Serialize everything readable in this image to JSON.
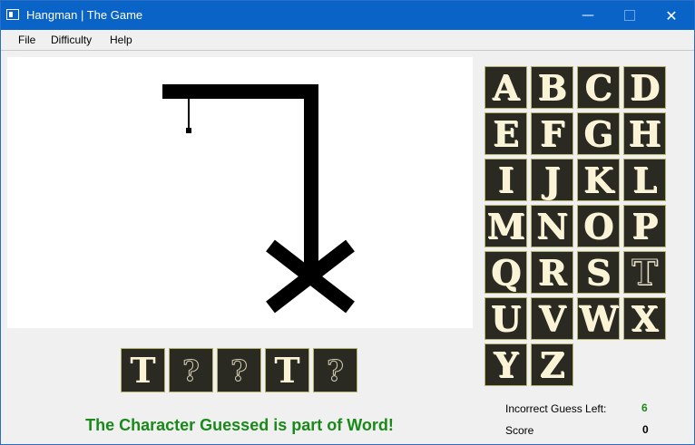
{
  "window": {
    "title": "Hangman | The Game",
    "minimize_glyph": "—",
    "close_glyph": "✕"
  },
  "menu": {
    "items": [
      "File",
      "Difficulty",
      "Help"
    ]
  },
  "keyboard": {
    "letters": [
      {
        "letter": "A",
        "used": false
      },
      {
        "letter": "B",
        "used": false
      },
      {
        "letter": "C",
        "used": false
      },
      {
        "letter": "D",
        "used": false
      },
      {
        "letter": "E",
        "used": false
      },
      {
        "letter": "F",
        "used": false
      },
      {
        "letter": "G",
        "used": false
      },
      {
        "letter": "H",
        "used": false
      },
      {
        "letter": "I",
        "used": false
      },
      {
        "letter": "J",
        "used": false
      },
      {
        "letter": "K",
        "used": false
      },
      {
        "letter": "L",
        "used": false
      },
      {
        "letter": "M",
        "used": false
      },
      {
        "letter": "N",
        "used": false
      },
      {
        "letter": "O",
        "used": false
      },
      {
        "letter": "P",
        "used": false
      },
      {
        "letter": "Q",
        "used": false
      },
      {
        "letter": "R",
        "used": false
      },
      {
        "letter": "S",
        "used": false
      },
      {
        "letter": "T",
        "used": true
      },
      {
        "letter": "U",
        "used": false
      },
      {
        "letter": "V",
        "used": false
      },
      {
        "letter": "W",
        "used": false
      },
      {
        "letter": "X",
        "used": false
      },
      {
        "letter": "Y",
        "used": false
      },
      {
        "letter": "Z",
        "used": false
      }
    ]
  },
  "word": {
    "slots": [
      {
        "char": "T",
        "revealed": true
      },
      {
        "char": "?",
        "revealed": false
      },
      {
        "char": "?",
        "revealed": false
      },
      {
        "char": "T",
        "revealed": true
      },
      {
        "char": "?",
        "revealed": false
      }
    ]
  },
  "status": {
    "message": "The Character Guessed is part of Word!",
    "color": "#198a19"
  },
  "stats": {
    "incorrect_label": "Incorrect  Guess Left:",
    "incorrect_value": "6",
    "incorrect_color": "#198a19",
    "score_label": "Score",
    "score_value": "0",
    "score_color": "#000000"
  },
  "colors": {
    "titlebar": "#0a64c8",
    "tile_bg": "#2a2a22",
    "tile_letter": "#fbf3d5"
  }
}
